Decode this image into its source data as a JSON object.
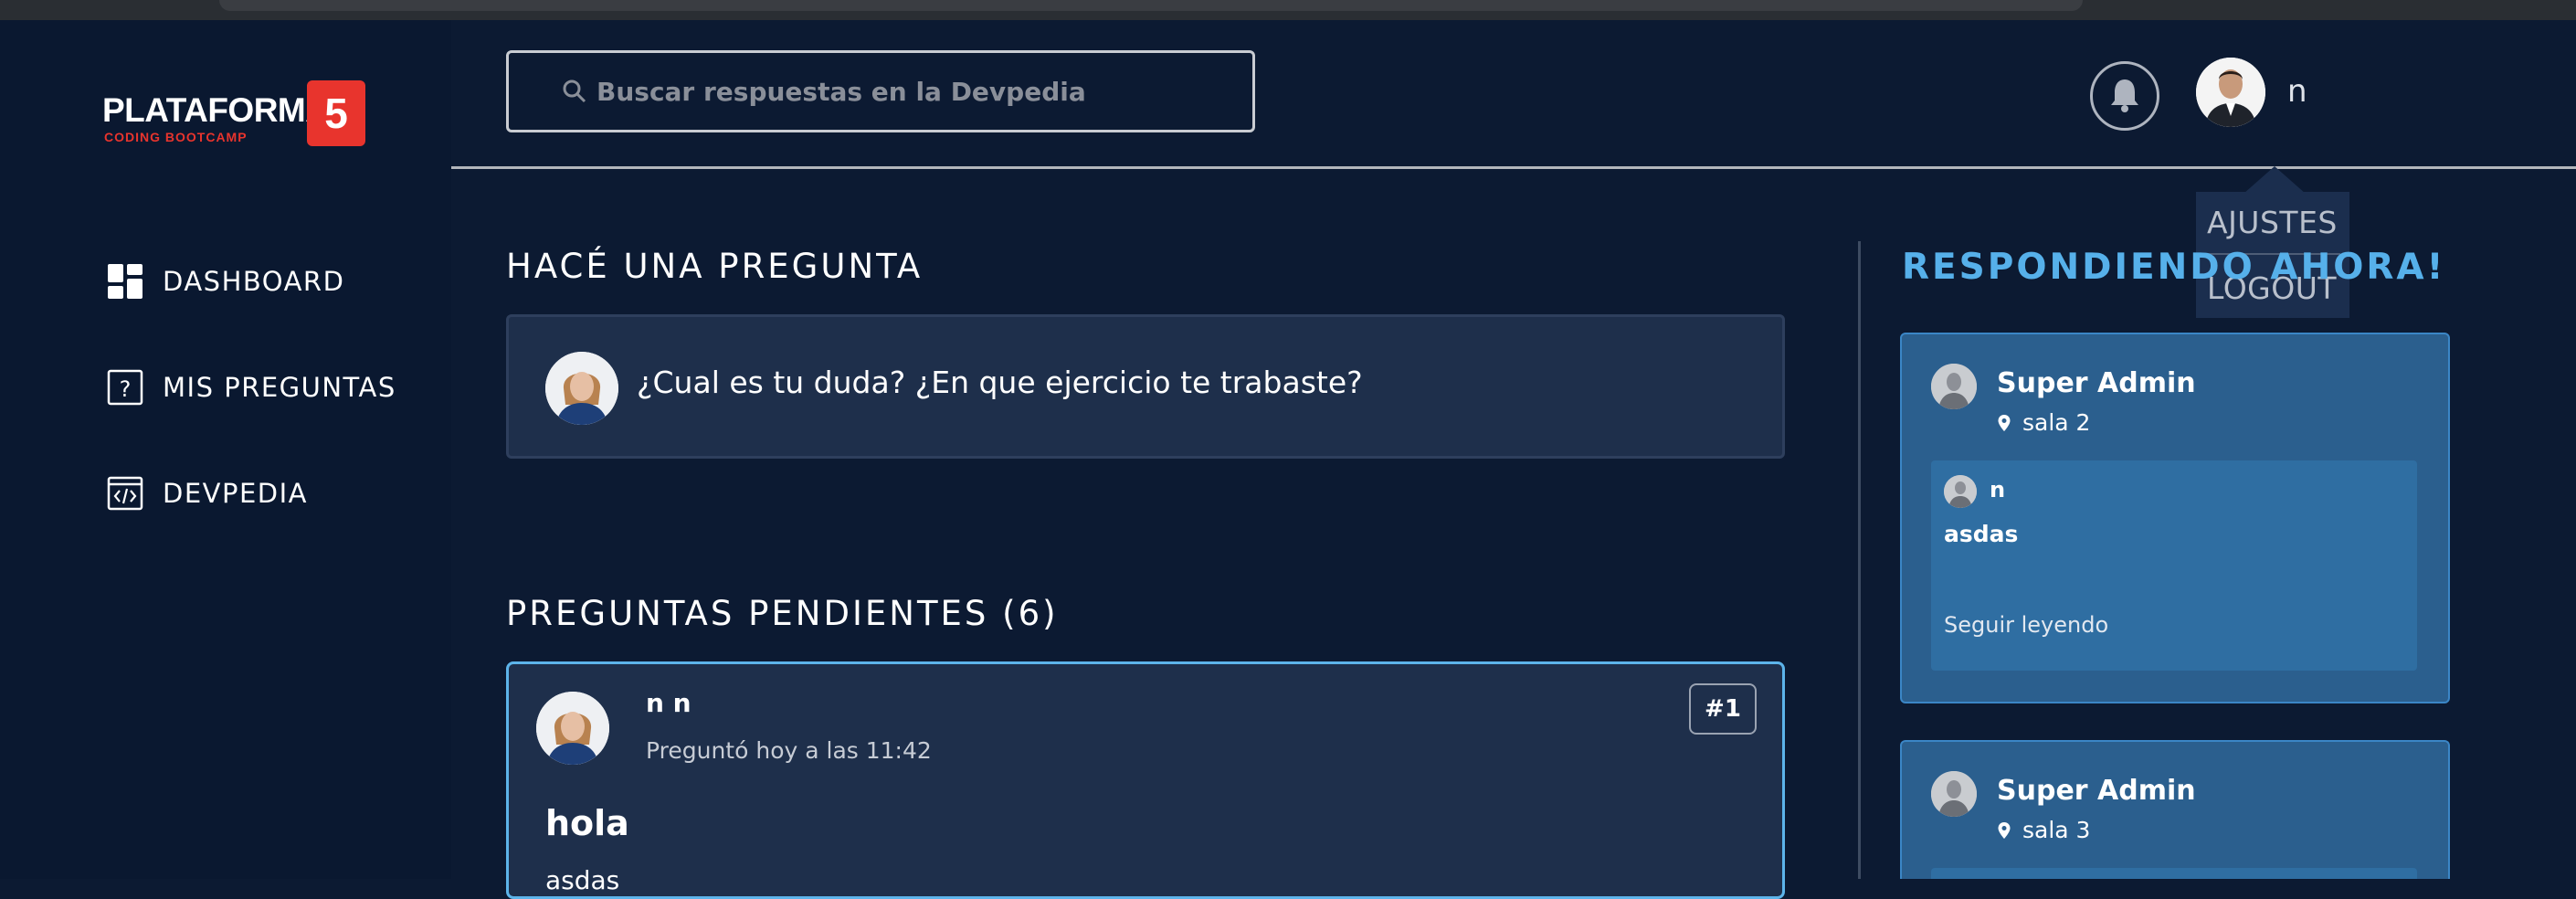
{
  "brand": {
    "name": "PLATAFORMA",
    "number": "5",
    "tagline": "CODING BOOTCAMP",
    "accent_color": "#e8342d"
  },
  "sidebar": {
    "items": [
      {
        "label": "DASHBOARD",
        "icon": "dashboard-grid-icon"
      },
      {
        "label": "MIS PREGUNTAS",
        "icon": "question-mark-box-icon"
      },
      {
        "label": "DEVPEDIA",
        "icon": "code-browser-icon"
      }
    ]
  },
  "header": {
    "search_placeholder": "Buscar respuestas en la Devpedia",
    "search_value": "",
    "user_name": "n",
    "icons": {
      "search": "search-icon",
      "notifications": "bell-icon"
    }
  },
  "user_menu": {
    "items": [
      "AJUSTES",
      "LOGOUT"
    ]
  },
  "ask": {
    "title": "HACÉ UNA PREGUNTA",
    "prompt": "¿Cual es tu duda? ¿En que ejercicio te trabaste?"
  },
  "pending": {
    "title": "PREGUNTAS PENDIENTES (6)",
    "questions": [
      {
        "author": "n n",
        "time": "Preguntó hoy a las 11:42",
        "number": "#1",
        "title": "hola",
        "body": "asdas"
      }
    ]
  },
  "answering": {
    "title": "RESPONDIENDO AHORA!",
    "rooms": [
      {
        "admin": "Super Admin",
        "room": "sala 2",
        "question": {
          "author": "n",
          "title": "asdas",
          "more": "Seguir leyendo"
        }
      },
      {
        "admin": "Super Admin",
        "room": "sala 3"
      }
    ]
  },
  "colors": {
    "background": "#0c1a32",
    "sidebar": "#0a1830",
    "card": "#1e2f4b",
    "highlight_border": "#5db4ea",
    "room_card": "#2b5f8e",
    "accent_text": "#56b0ea"
  }
}
